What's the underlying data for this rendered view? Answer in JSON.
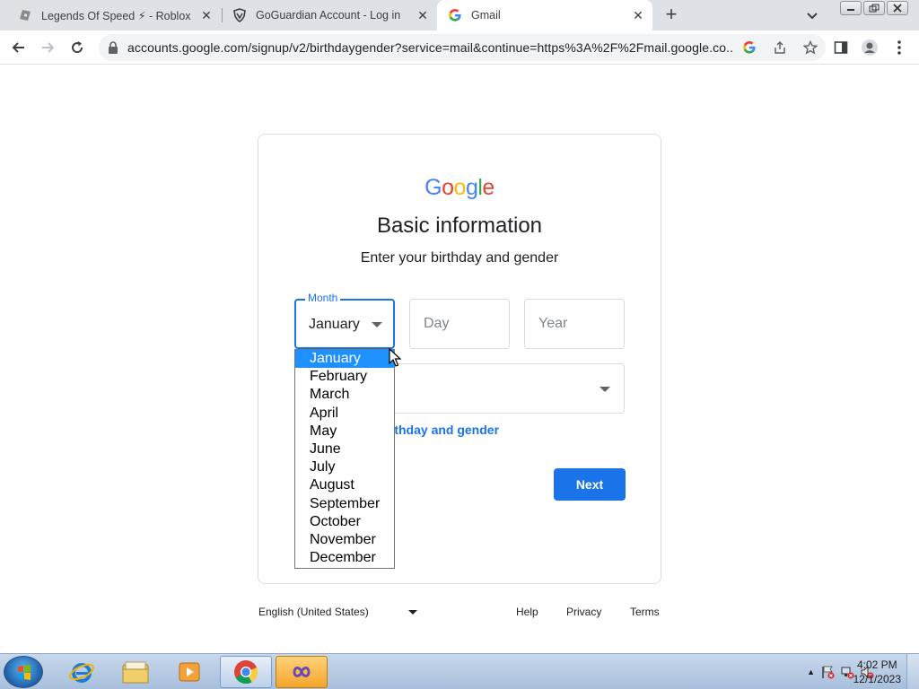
{
  "browser": {
    "tabs": [
      {
        "title": "Legends Of Speed ⚡ - Roblox",
        "icon": "roblox-icon"
      },
      {
        "title": "GoGuardian Account - Log in",
        "icon": "goguardian-icon"
      },
      {
        "title": "Gmail",
        "icon": "google-g-icon",
        "active": true
      }
    ],
    "url": "accounts.google.com/signup/v2/birthdaygender?service=mail&continue=https%3A%2F%2Fmail.google.co..."
  },
  "page": {
    "logo": {
      "G": "G",
      "o1": "o",
      "o2": "o",
      "g": "g",
      "l": "l",
      "e": "e"
    },
    "logo_colors": [
      "#4285F4",
      "#EA4335",
      "#FBBC05",
      "#4285F4",
      "#34A853",
      "#EA4335"
    ],
    "title": "Basic information",
    "subtitle": "Enter your birthday and gender",
    "month": {
      "label": "Month",
      "value": "January"
    },
    "day_placeholder": "Day",
    "year_placeholder": "Year",
    "why_link": "irthday and gender",
    "next_label": "Next"
  },
  "dropdown": {
    "options": [
      "January",
      "February",
      "March",
      "April",
      "May",
      "June",
      "July",
      "August",
      "September",
      "October",
      "November",
      "December"
    ],
    "selected": "January"
  },
  "footer": {
    "language": "English (United States)",
    "help": "Help",
    "privacy": "Privacy",
    "terms": "Terms"
  },
  "taskbar": {
    "time": "4:02 PM",
    "date": "12/1/2023"
  },
  "colors": {
    "accent": "#1a73e8",
    "selected_option": "#1e90ff"
  }
}
